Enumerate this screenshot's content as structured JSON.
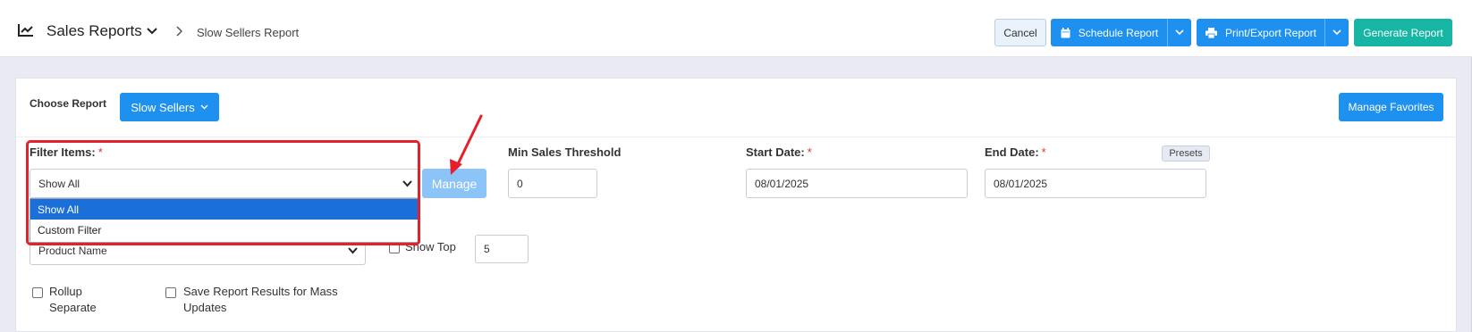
{
  "header": {
    "title": "Sales Reports",
    "breadcrumb": "Slow Sellers Report",
    "cancel_label": "Cancel",
    "schedule_label": "Schedule Report",
    "print_label": "Print/Export Report",
    "generate_label": "Generate Report"
  },
  "report": {
    "choose_label": "Choose Report",
    "selected_report": "Slow Sellers",
    "favorites_label": "Manage Favorites"
  },
  "filters": {
    "filter_items_label": "Filter Items:",
    "filter_items_value": "Show All",
    "filter_items_options": [
      "Show All",
      "Custom Filter"
    ],
    "manage_label": "Manage",
    "min_sales_label": "Min Sales Threshold",
    "min_sales_value": "0",
    "start_date_label": "Start Date:",
    "start_date_value": "08/01/2025",
    "end_date_label": "End Date:",
    "end_date_value": "08/01/2025",
    "presets_label": "Presets",
    "required_mark": "*",
    "group_by_value": "Product Name",
    "show_top_label": "Show Top",
    "show_top_value": "5",
    "rollup_label_1": "Rollup",
    "rollup_label_2": "Separate",
    "save_results_label_1": "Save Report Results for Mass",
    "save_results_label_2": "Updates"
  },
  "colors": {
    "primary": "#1e90f0",
    "teal": "#17b6a4",
    "highlight": "#e5202a",
    "selection": "#1a6fd8"
  }
}
